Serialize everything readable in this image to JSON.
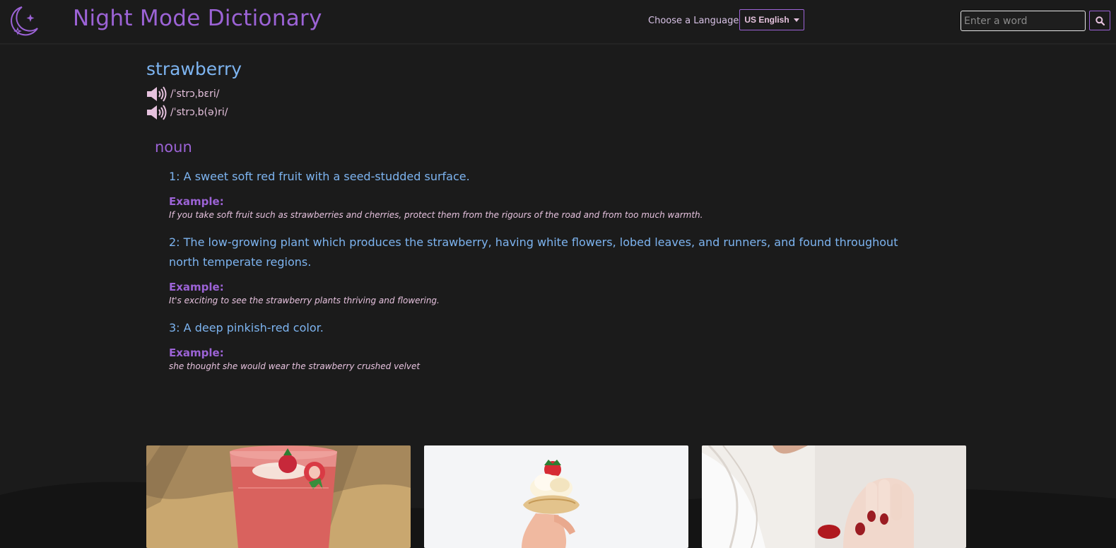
{
  "header": {
    "brand": "Night Mode Dictionary",
    "logo_icon": "moon-stars-icon",
    "language_label": "Choose a Language",
    "language_selected": "US English",
    "search_placeholder": "Enter a word",
    "search_icon": "search-icon",
    "accent_color": "#9c63d6"
  },
  "entry": {
    "word": "strawberry",
    "phonetics": [
      {
        "text": "/ˈstrɔˌbɛri/",
        "icon": "speaker-icon"
      },
      {
        "text": "/ˈstrɔˌb(ə)ri/",
        "icon": "speaker-icon"
      }
    ],
    "part_of_speech": "noun",
    "definitions": [
      {
        "text": "1: A sweet soft red fruit with a seed-studded surface.",
        "example_label": "Example:",
        "example": "If you take soft fruit such as strawberries and cherries, protect them from the rigours of the road and from too much warmth."
      },
      {
        "text": "2: The low-growing plant which produces the strawberry, having white flowers, lobed leaves, and runners, and found throughout north temperate regions.",
        "example_label": "Example:",
        "example": "It's exciting to see the strawberry plants thriving and flowering."
      },
      {
        "text": "3: A deep pinkish-red color.",
        "example_label": "Example:",
        "example": "she thought she would wear the strawberry crushed velvet"
      }
    ]
  },
  "gallery": {
    "images": [
      {
        "subject": "strawberry smoothie"
      },
      {
        "subject": "cream cupcake with strawberry"
      },
      {
        "subject": "hand holding strawberry"
      }
    ]
  }
}
